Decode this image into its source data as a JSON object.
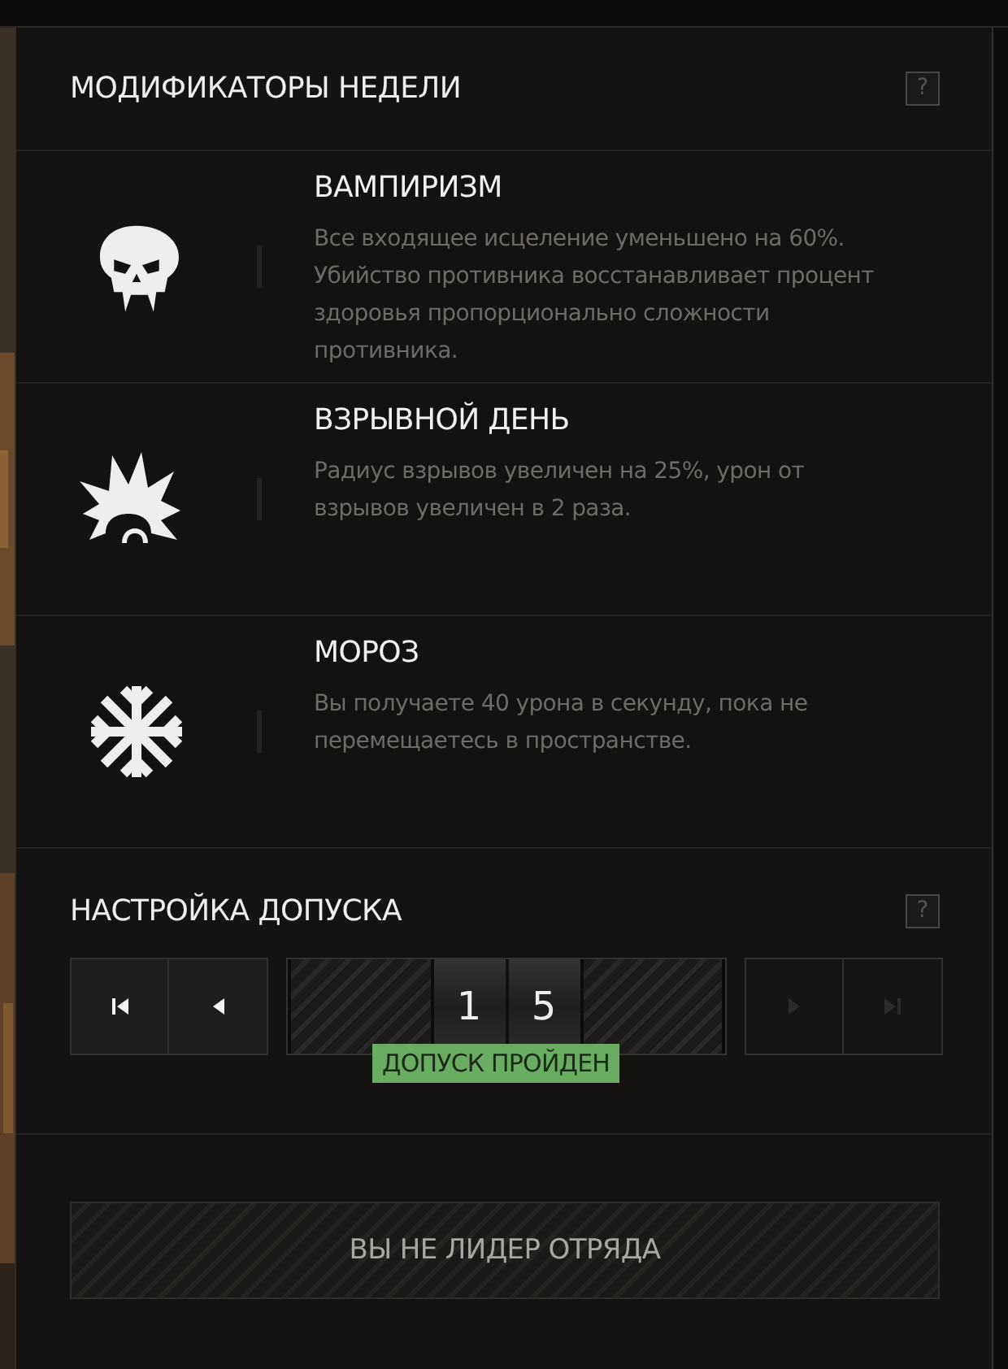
{
  "weekly_modifiers": {
    "title": "МОДИФИКАТОРЫ НЕДЕЛИ",
    "help": "?",
    "items": [
      {
        "kind": "skull",
        "name": "ВАМПИРИЗМ",
        "description": "Все входящее исцеление уменьшено на 60%. Убийство противника восстанавливает процент здоровья пропорционально сложности противника."
      },
      {
        "kind": "explosion",
        "name": "ВЗРЫВНОЙ ДЕНЬ",
        "description": "Радиус взрывов увеличен на 25%, урон от взрывов увеличен в 2 раза."
      },
      {
        "kind": "snowflake",
        "name": "МОРОЗ",
        "description": "Вы получаете 40 урона в секунду, пока не перемещаетесь в пространстве."
      }
    ]
  },
  "clearance": {
    "title": "НАСТРОЙКА ДОПУСКА",
    "help": "?",
    "buttons": [
      {
        "kind": "first",
        "disabled": false
      },
      {
        "kind": "prev",
        "disabled": false
      },
      {
        "kind": "next",
        "disabled": true
      },
      {
        "kind": "last",
        "disabled": true
      }
    ],
    "digits": [
      "1",
      "5"
    ],
    "status": "ДОПУСК ПРОЙДЕН"
  },
  "leader_button": {
    "label": "ВЫ НЕ ЛИДЕР ОТРЯДА",
    "disabled": true
  }
}
